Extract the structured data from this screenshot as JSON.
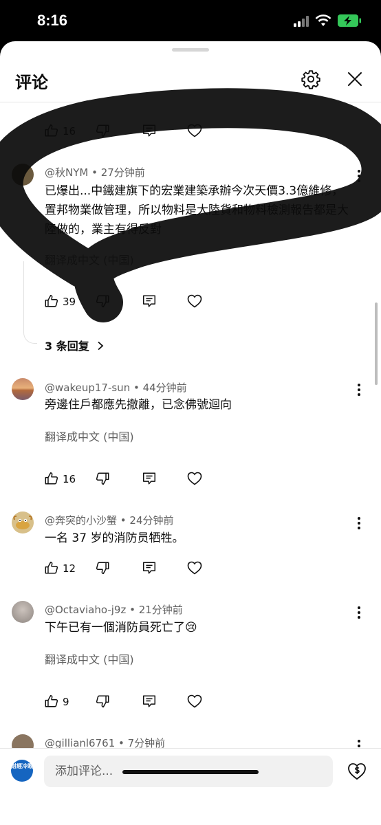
{
  "status_bar": {
    "time": "8:16"
  },
  "header": {
    "title": "评论",
    "settings_icon": "gear-icon",
    "close_icon": "close-icon"
  },
  "comments": [
    {
      "likes": "16"
    },
    {
      "author": "@秋NYM",
      "age": "27分钟前",
      "text": "已爆出...中鐵建旗下的宏業建築承辦今次天價3.3億維修，置邦物業做管理，所以物料是大陸貨和物料檢測報告都是大陸做的，業主有得反對",
      "translate": "翻译成中文 (中国)",
      "likes": "39",
      "replies": "3 条回复"
    },
    {
      "author": "@wakeup17-sun",
      "age": "44分钟前",
      "text": "旁邊住戶都應先撤離，已念佛號迴向",
      "translate": "翻译成中文 (中国)",
      "likes": "16"
    },
    {
      "author": "@奔突的小沙蟹",
      "age": "24分钟前",
      "text": "一名 37 岁的消防员牺牲。",
      "likes": "12"
    },
    {
      "author": "@Octaviaho-j9z",
      "age": "21分钟前",
      "text": "下午已有一個消防員死亡了😢",
      "translate": "翻译成中文 (中国)",
      "likes": "9"
    },
    {
      "author": "@gillianl6761",
      "age": "7分钟前"
    }
  ],
  "composer": {
    "channel_avatar_text": "財經冷眼",
    "placeholder": "添加评论..."
  },
  "colors": {
    "text": "#0f0f0f",
    "secondary": "#606060",
    "accent_battery": "#34c759"
  }
}
